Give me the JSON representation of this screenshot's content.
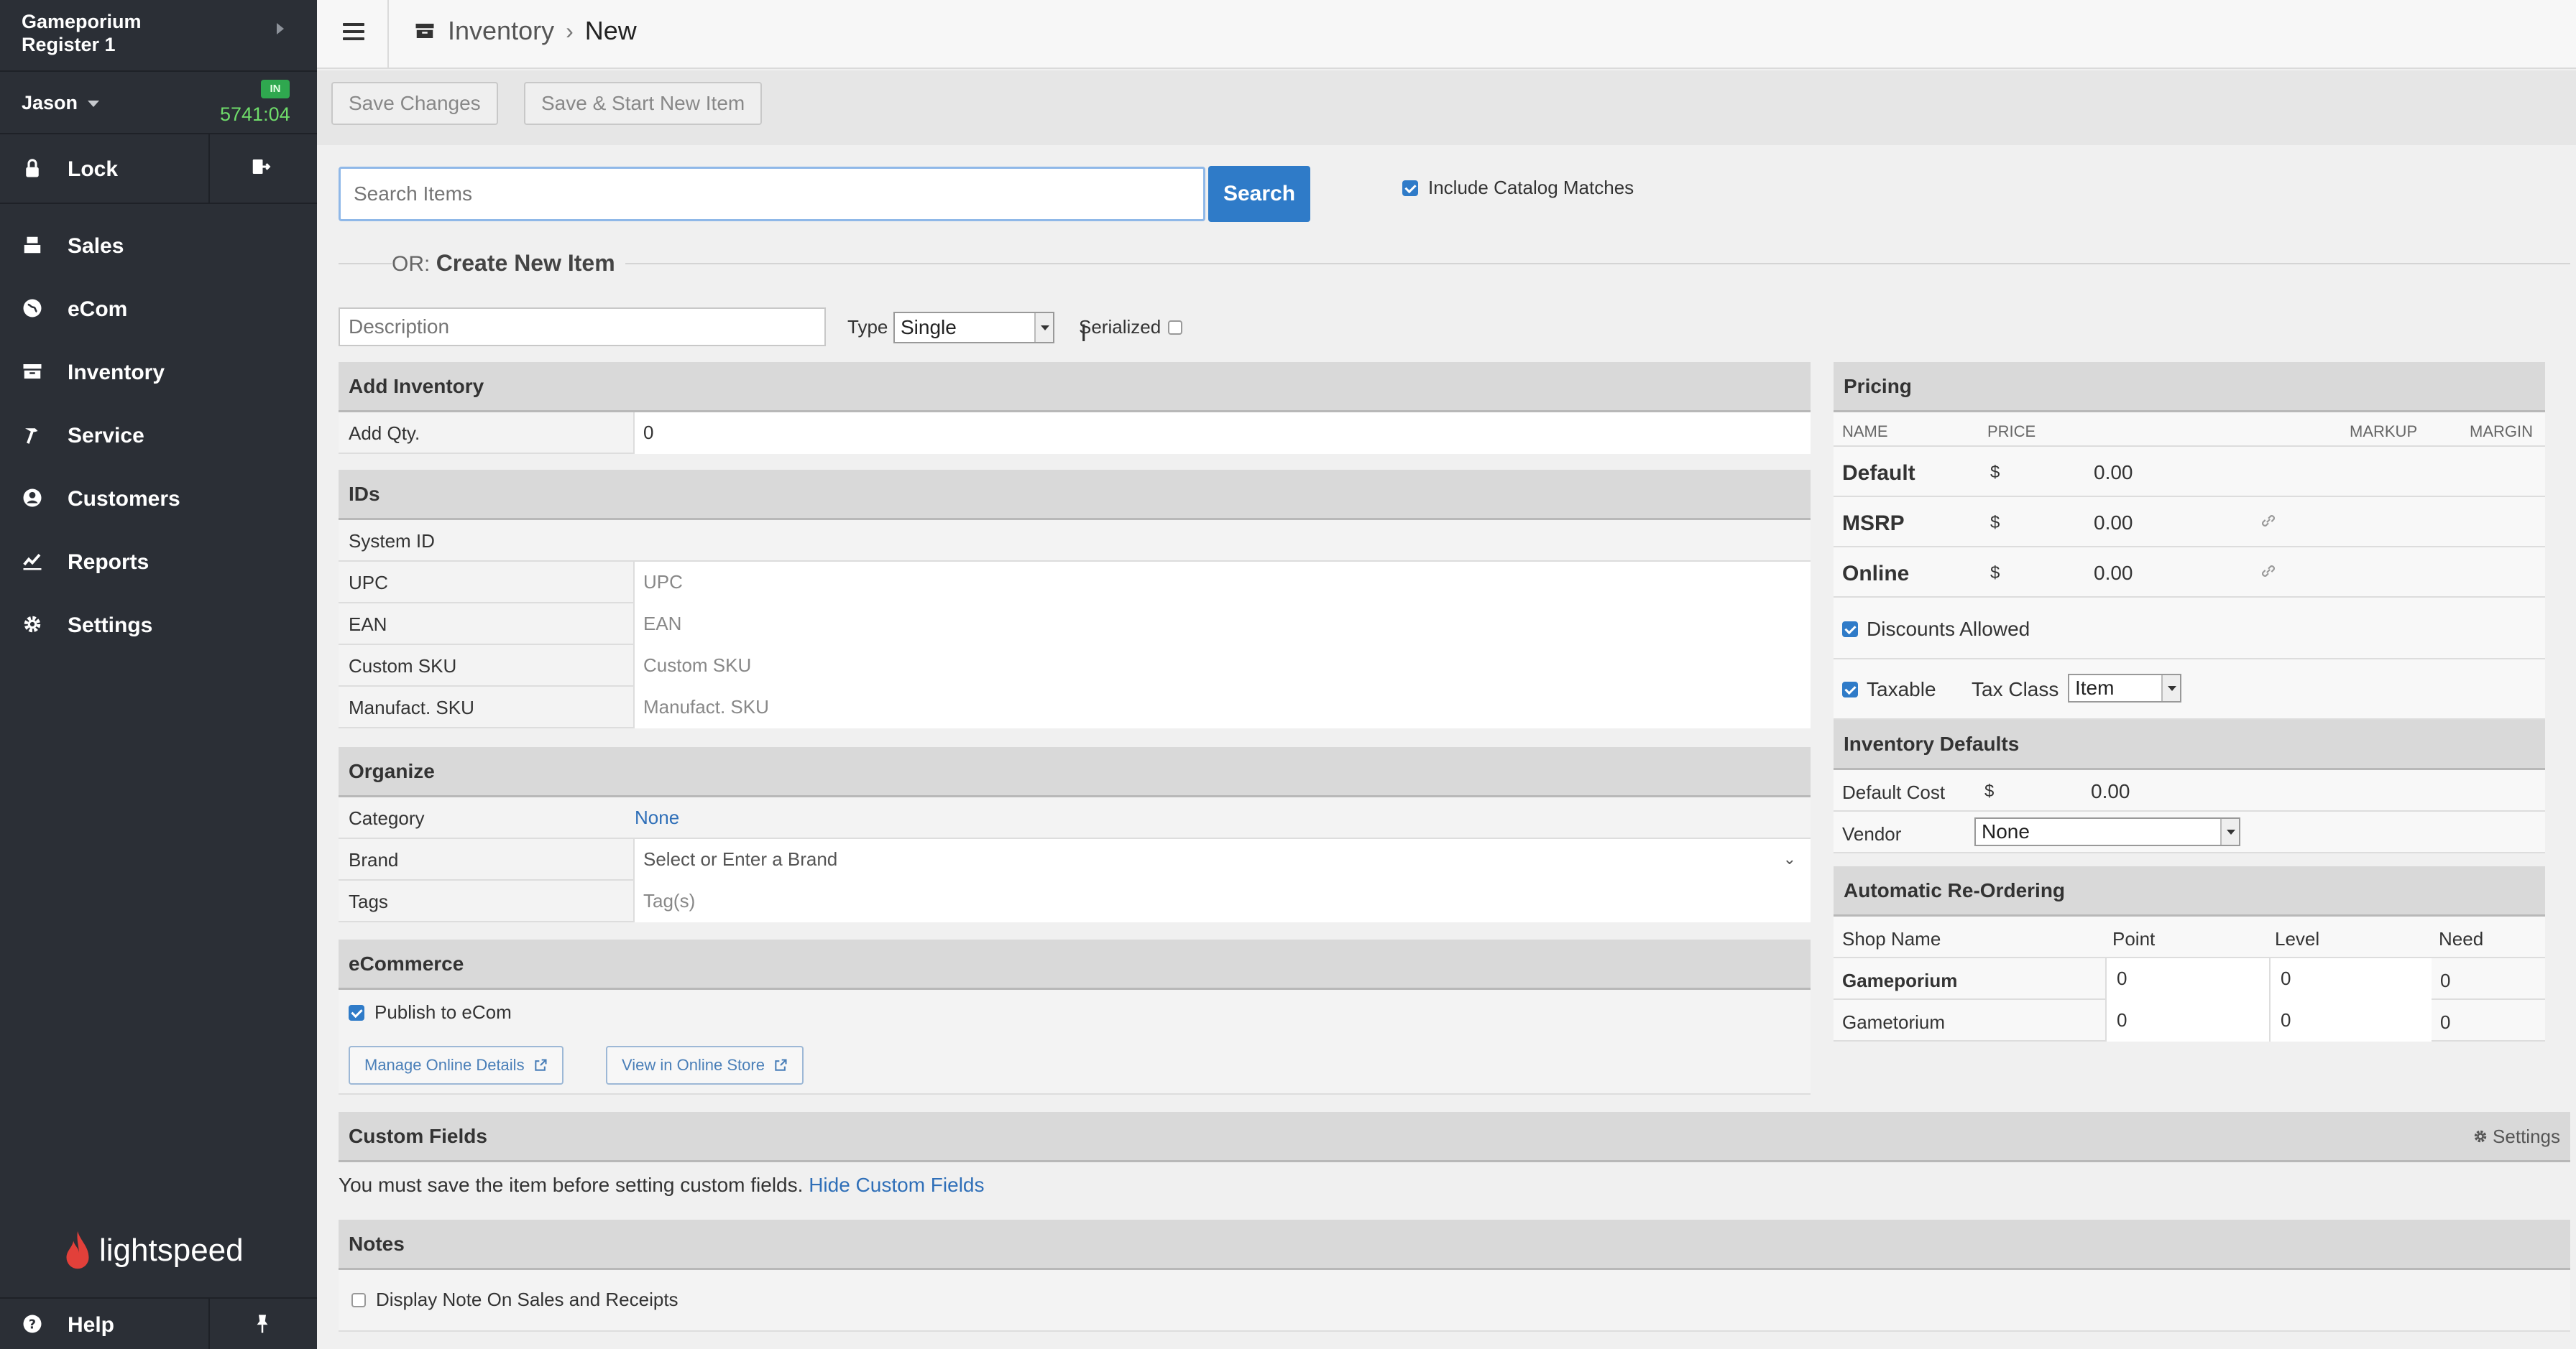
{
  "sidebar": {
    "store": "Gameporium",
    "register": "Register 1",
    "user": "Jason",
    "badge": "IN",
    "timer": "5741:04",
    "lock_label": "Lock",
    "items": [
      {
        "label": "Sales",
        "icon": "register-icon"
      },
      {
        "label": "eCom",
        "icon": "globe-icon"
      },
      {
        "label": "Inventory",
        "icon": "inventory-icon"
      },
      {
        "label": "Service",
        "icon": "hammer-icon"
      },
      {
        "label": "Customers",
        "icon": "user-icon"
      },
      {
        "label": "Reports",
        "icon": "chart-icon"
      },
      {
        "label": "Settings",
        "icon": "gear-icon"
      }
    ],
    "logo": "lightspeed",
    "help_label": "Help"
  },
  "header": {
    "breadcrumb_1": "Inventory",
    "breadcrumb_sep": "›",
    "breadcrumb_2": "New"
  },
  "toolbar": {
    "save_label": "Save Changes",
    "save_new_label": "Save & Start New Item"
  },
  "search": {
    "placeholder": "Search Items",
    "button": "Search",
    "include_catalog": "Include Catalog Matches"
  },
  "create": {
    "or": "OR:",
    "title": "Create New Item",
    "description_placeholder": "Description",
    "type_label": "Type",
    "type_value": "Single",
    "serialized_label": "Serialized"
  },
  "add_inventory": {
    "title": "Add Inventory",
    "qty_label": "Add Qty.",
    "qty_value": "0"
  },
  "ids": {
    "title": "IDs",
    "rows": [
      {
        "label": "System ID",
        "value": ""
      },
      {
        "label": "UPC",
        "value": "UPC"
      },
      {
        "label": "EAN",
        "value": "EAN"
      },
      {
        "label": "Custom SKU",
        "value": "Custom SKU"
      },
      {
        "label": "Manufact. SKU",
        "value": "Manufact. SKU"
      }
    ]
  },
  "organize": {
    "title": "Organize",
    "category_label": "Category",
    "category_value": "None",
    "brand_label": "Brand",
    "brand_value": "Select or Enter a Brand",
    "tags_label": "Tags",
    "tags_value": "Tag(s)"
  },
  "ecommerce": {
    "title": "eCommerce",
    "publish_label": "Publish to eCom",
    "manage_button": "Manage Online Details",
    "view_button": "View in Online Store"
  },
  "pricing": {
    "title": "Pricing",
    "col_name": "NAME",
    "col_price": "PRICE",
    "col_markup": "MARKUP",
    "col_margin": "MARGIN",
    "rows": [
      {
        "name": "Default",
        "currency": "$",
        "price": "0.00"
      },
      {
        "name": "MSRP",
        "currency": "$",
        "price": "0.00"
      },
      {
        "name": "Online",
        "currency": "$",
        "price": "0.00"
      }
    ],
    "discounts_label": "Discounts Allowed",
    "taxable_label": "Taxable",
    "tax_class_label": "Tax Class",
    "tax_class_value": "Item"
  },
  "inventory_defaults": {
    "title": "Inventory Defaults",
    "cost_label": "Default Cost",
    "cost_currency": "$",
    "cost_value": "0.00",
    "vendor_label": "Vendor",
    "vendor_value": "None"
  },
  "reorder": {
    "title": "Automatic Re-Ordering",
    "col_shop": "Shop Name",
    "col_point": "Point",
    "col_level": "Level",
    "col_need": "Need",
    "rows": [
      {
        "shop": "Gameporium",
        "point": "0",
        "level": "0",
        "need": "0"
      },
      {
        "shop": "Gametorium",
        "point": "0",
        "level": "0",
        "need": "0"
      }
    ]
  },
  "custom_fields": {
    "title": "Custom Fields",
    "settings": "Settings",
    "note": "You must save the item before setting custom fields.",
    "hide_link": "Hide Custom Fields"
  },
  "notes": {
    "title": "Notes",
    "display_label": "Display Note On Sales and Receipts"
  },
  "colors": {
    "sidebar": "#2b2f36",
    "accent": "#2f7bc8",
    "timer": "#6fdc6a"
  }
}
